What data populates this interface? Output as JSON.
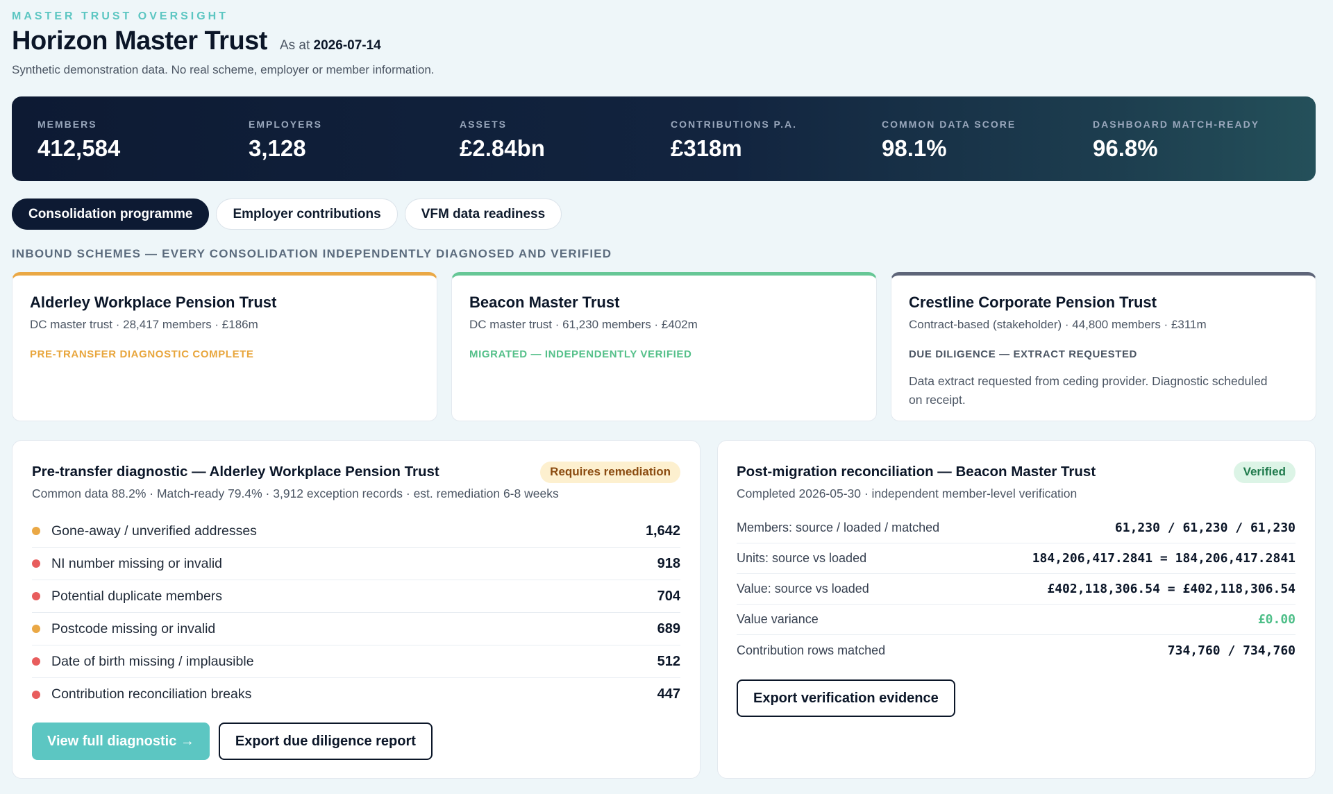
{
  "header": {
    "eyebrow": "MASTER TRUST OVERSIGHT",
    "title": "Horizon Master Trust",
    "as_at_prefix": "As at",
    "as_at_date": "2026-07-14",
    "subtitle": "Synthetic demonstration data. No real scheme, employer or member information."
  },
  "kpis": [
    {
      "label": "MEMBERS",
      "value": "412,584"
    },
    {
      "label": "EMPLOYERS",
      "value": "3,128"
    },
    {
      "label": "ASSETS",
      "value": "£2.84bn"
    },
    {
      "label": "CONTRIBUTIONS P.A.",
      "value": "£318m"
    },
    {
      "label": "COMMON DATA SCORE",
      "value": "98.1%"
    },
    {
      "label": "DASHBOARD MATCH-READY",
      "value": "96.8%"
    }
  ],
  "tabs": [
    {
      "label": "Consolidation programme",
      "active": true
    },
    {
      "label": "Employer contributions",
      "active": false
    },
    {
      "label": "VFM data readiness",
      "active": false
    }
  ],
  "section_heading": "INBOUND SCHEMES — EVERY CONSOLIDATION INDEPENDENTLY DIAGNOSED AND VERIFIED",
  "schemes": [
    {
      "name": "Alderley Workplace Pension Trust",
      "meta": "DC master trust · 28,417 members · £186m",
      "status": "PRE-TRANSFER DIAGNOSTIC COMPLETE",
      "note": "",
      "accent": "#eaa845"
    },
    {
      "name": "Beacon Master Trust",
      "meta": "DC master trust · 61,230 members · £402m",
      "status": "MIGRATED — INDEPENDENTLY VERIFIED",
      "note": "",
      "accent": "#66c796"
    },
    {
      "name": "Crestline Corporate Pension Trust",
      "meta": "Contract-based (stakeholder) · 44,800 members · £311m",
      "status": "DUE DILIGENCE — EXTRACT REQUESTED",
      "note": "Data extract requested from ceding provider. Diagnostic scheduled on receipt.",
      "accent": "#5e6579"
    }
  ],
  "diagnostic": {
    "title": "Pre-transfer diagnostic — Alderley Workplace Pension Trust",
    "badge": "Requires remediation",
    "subtitle": "Common data 88.2% · Match-ready 79.4% · 3,912 exception records · est. remediation 6-8 weeks",
    "exceptions": [
      {
        "label": "Gone-away / unverified addresses",
        "count": "1,642",
        "severity": "amber"
      },
      {
        "label": "NI number missing or invalid",
        "count": "918",
        "severity": "red"
      },
      {
        "label": "Potential duplicate members",
        "count": "704",
        "severity": "red"
      },
      {
        "label": "Postcode missing or invalid",
        "count": "689",
        "severity": "amber"
      },
      {
        "label": "Date of birth missing / implausible",
        "count": "512",
        "severity": "red"
      },
      {
        "label": "Contribution reconciliation breaks",
        "count": "447",
        "severity": "red"
      }
    ],
    "primary_button": "View full diagnostic →",
    "secondary_button": "Export due diligence report"
  },
  "reconciliation": {
    "title": "Post-migration reconciliation — Beacon Master Trust",
    "badge": "Verified",
    "subtitle": "Completed 2026-05-30 · independent member-level verification",
    "rows": [
      {
        "label": "Members: source / loaded / matched",
        "value": "61,230 / 61,230 / 61,230"
      },
      {
        "label": "Units: source vs loaded",
        "value": "184,206,417.2841 = 184,206,417.2841"
      },
      {
        "label": "Value: source vs loaded",
        "value": "£402,118,306.54 = £402,118,306.54"
      },
      {
        "label": "Value variance",
        "value": "£0.00"
      },
      {
        "label": "Contribution rows matched",
        "value": "734,760 / 734,760"
      }
    ],
    "button": "Export verification evidence"
  },
  "colors": {
    "accent_teal": "#5cc6c2",
    "banner_dark": "#0d1a33",
    "status_amber": "#eaa845",
    "status_green": "#66c796",
    "status_red": "#e85d5d"
  }
}
